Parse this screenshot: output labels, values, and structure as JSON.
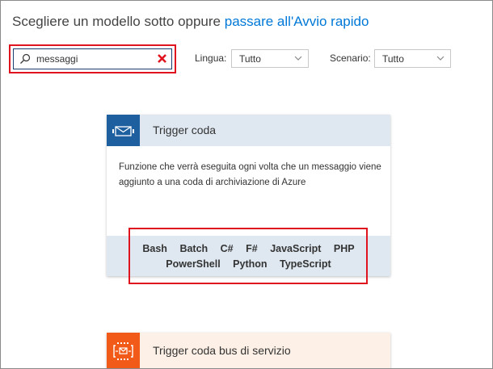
{
  "header": {
    "prefix": "Scegliere un modello sotto oppure ",
    "link": "passare all'Avvio rapido"
  },
  "search": {
    "value": "messaggi",
    "placeholder": ""
  },
  "filters": {
    "language_label": "Lingua:",
    "language_value": "Tutto",
    "scenario_label": "Scenario:",
    "scenario_value": "Tutto"
  },
  "cards": [
    {
      "title": "Trigger coda",
      "description": "Funzione che verrà eseguita ogni volta che un messaggio viene aggiunto a una coda di archiviazione di Azure",
      "icon": "envelope-icon",
      "languages_row1": [
        "Bash",
        "Batch",
        "C#",
        "F#",
        "JavaScript",
        "PHP"
      ],
      "languages_row2": [
        "PowerShell",
        "Python",
        "TypeScript"
      ]
    },
    {
      "title": "Trigger coda bus di servizio",
      "icon": "service-bus-icon"
    }
  ],
  "colors": {
    "link": "#0078d7",
    "highlight": "#e0141e",
    "card1_accent": "#1e5fa0",
    "card1_band": "#dfe8f1",
    "card2_accent": "#f25a1a",
    "card2_band": "#fdf0e6"
  }
}
